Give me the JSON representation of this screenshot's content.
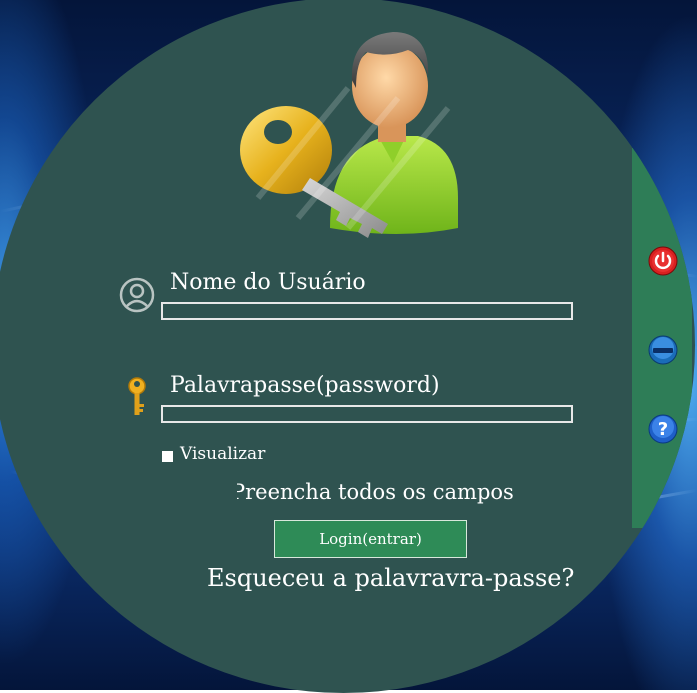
{
  "login": {
    "username_label": "Nome do Usuário",
    "username_value": "",
    "password_label": "Palavrapasse(password)",
    "password_value": "",
    "show_password_label": "Visualizar",
    "show_password_checked": false,
    "status_message": "Preencha todos os campos",
    "login_button_label": "Login(entrar)",
    "forgot_password_link": "Esqueceu a palavravra-passe?"
  },
  "side_panel": {
    "buttons": [
      {
        "icon": "power-icon"
      },
      {
        "icon": "minimize-icon"
      },
      {
        "icon": "help-icon"
      }
    ]
  },
  "colors": {
    "circle_background": "#2f5350",
    "side_panel": "#2e7d57",
    "login_button": "#2e8b57",
    "text": "#ffffff"
  }
}
